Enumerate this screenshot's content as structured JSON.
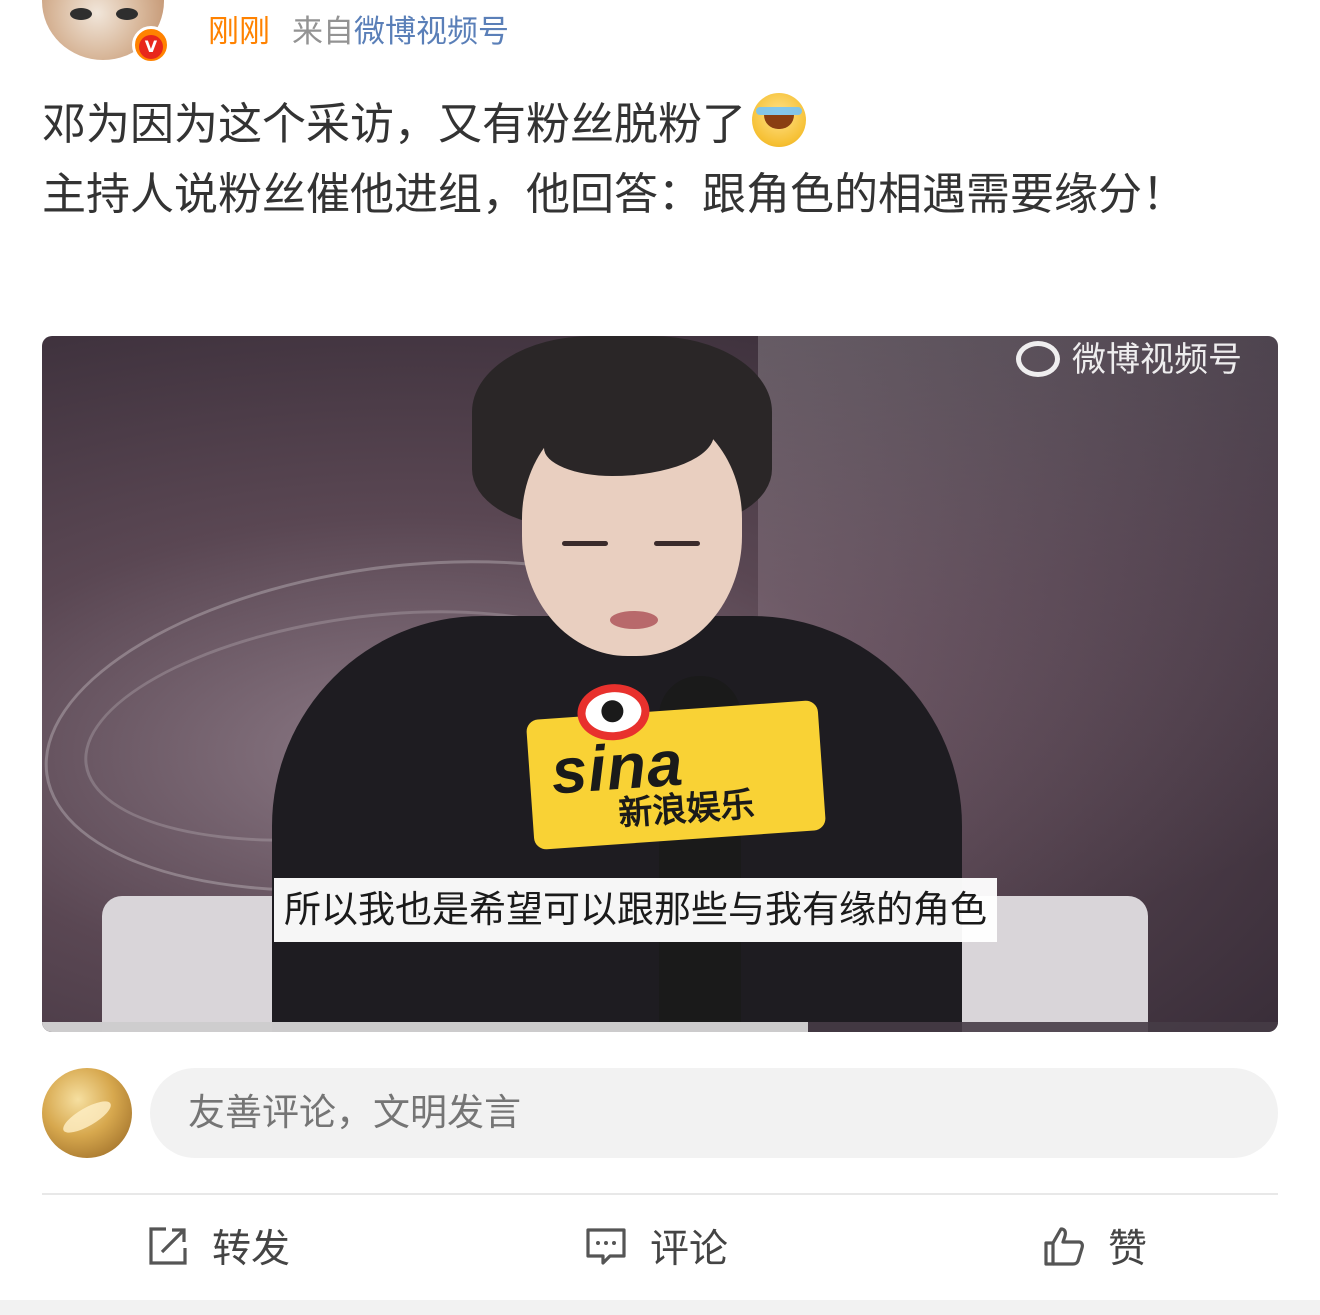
{
  "header": {
    "time": "刚刚",
    "from_prefix": "来自",
    "source": "微博视频号"
  },
  "post": {
    "line1": "邓为因为这个采访，又有粉丝脱粉了",
    "emoji": "laughing-crying-emoji",
    "line2": "主持人说粉丝催他进组，他回答：跟角色的相遇需要缘分！"
  },
  "video": {
    "watermark": "微博视频号",
    "subtitle": "所以我也是希望可以跟那些与我有缘的角色",
    "progress": 0.62
  },
  "comment": {
    "placeholder": "友善评论，文明发言"
  },
  "actions": {
    "share_label": "转发",
    "comment_label": "评论",
    "like_label": "赞"
  },
  "colors": {
    "time": "#ff8200",
    "source_link": "#5a7fb8",
    "verified_badge": "#ff8200"
  }
}
